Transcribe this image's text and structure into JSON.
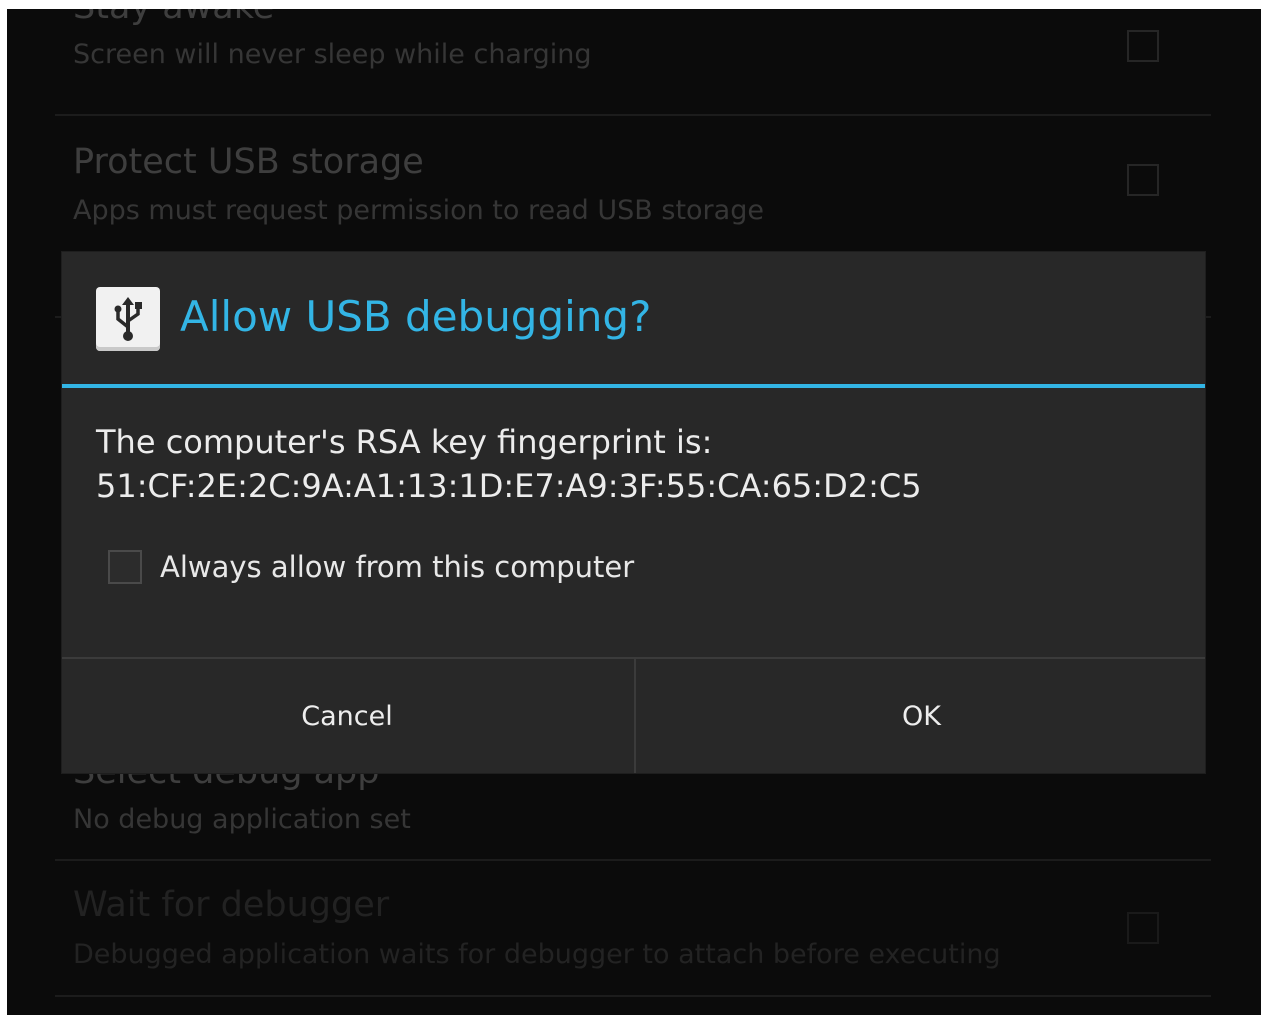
{
  "settings": [
    {
      "title": "Stay awake",
      "summary": "Screen will never sleep while charging",
      "checked": false
    },
    {
      "title": "Protect USB storage",
      "summary": "Apps must request permission to read USB storage",
      "checked": false
    },
    {
      "title": "Select debug app",
      "summary": "No debug application set"
    },
    {
      "title": "Wait for debugger",
      "summary": "Debugged application waits for debugger to attach before executing",
      "checked": false
    }
  ],
  "dialog": {
    "icon": "usb-icon",
    "title": "Allow USB debugging?",
    "message_line1": "The computer's RSA key fingerprint is:",
    "fingerprint": "51:CF:2E:2C:9A:A1:13:1D:E7:A9:3F:55:CA:65:D2:C5",
    "always_allow_label": "Always allow from this computer",
    "always_allow_checked": false,
    "cancel_label": "Cancel",
    "ok_label": "OK"
  },
  "colors": {
    "accent": "#33b5e5",
    "background": "#0b0b0b",
    "dialog_background": "#282828"
  }
}
